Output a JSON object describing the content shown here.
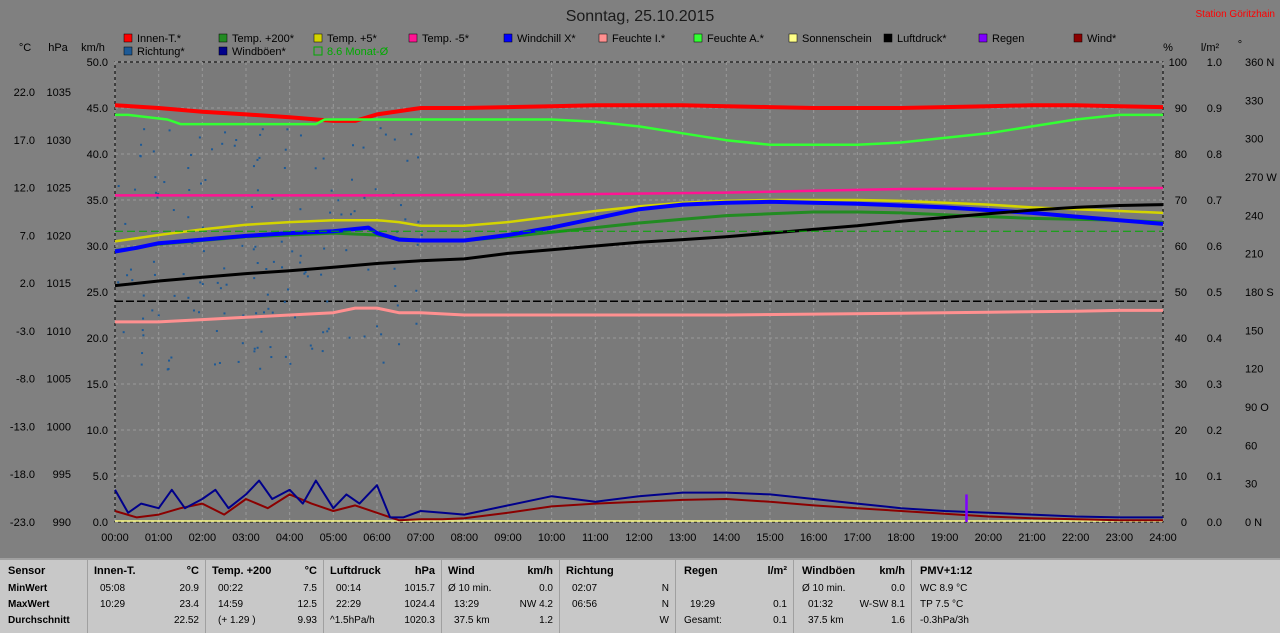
{
  "title": "Sonntag, 25.10.2015",
  "station": "Station Göritzhain",
  "left_units": {
    "c": "°C",
    "hpa": "hPa",
    "kmh": "km/h"
  },
  "right_units": {
    "pct": "%",
    "lm2": "l/m²",
    "deg": "°"
  },
  "legend": [
    {
      "label": "Innen-T.*",
      "color": "#ff0000"
    },
    {
      "label": "Temp. +200*",
      "color": "#228b22"
    },
    {
      "label": "Temp. +5*",
      "color": "#d4d400"
    },
    {
      "label": "Temp. -5*",
      "color": "#ff1493"
    },
    {
      "label": "Windchill X*",
      "color": "#0000ff"
    },
    {
      "label": "Feuchte I.*",
      "color": "#ff9090"
    },
    {
      "label": "Feuchte A.*",
      "color": "#33ff33"
    },
    {
      "label": "Sonnenschein",
      "color": "#ffff88"
    },
    {
      "label": "Luftdruck*",
      "color": "#000000"
    },
    {
      "label": "Regen",
      "color": "#8000ff"
    },
    {
      "label": "Wind*",
      "color": "#8b0000"
    },
    {
      "label": "Richtung*",
      "color": "#1e5a96"
    },
    {
      "label": "Windböen*",
      "color": "#00008b"
    },
    {
      "label": "8.6 Monat-Ø",
      "color": "#00aa00"
    }
  ],
  "chart_data": {
    "type": "line",
    "x_ticks": [
      "00:00",
      "01:00",
      "02:00",
      "03:00",
      "04:00",
      "05:00",
      "06:00",
      "07:00",
      "08:00",
      "09:00",
      "10:00",
      "11:00",
      "12:00",
      "13:00",
      "14:00",
      "15:00",
      "16:00",
      "17:00",
      "18:00",
      "19:00",
      "20:00",
      "21:00",
      "22:00",
      "23:00",
      "24:00"
    ],
    "axis_temp_c": [
      "22.0",
      "17.0",
      "12.0",
      "7.0",
      "2.0",
      "-3.0",
      "-8.0",
      "-13.0",
      "-18.0",
      "-23.0"
    ],
    "axis_pressure_hpa": [
      "1035",
      "1030",
      "1025",
      "1020",
      "1015",
      "1010",
      "1005",
      "1000",
      "995",
      "990"
    ],
    "axis_wind_kmh": [
      "50.0",
      "45.0",
      "40.0",
      "35.0",
      "30.0",
      "25.0",
      "20.0",
      "15.0",
      "10.0",
      "5.0",
      "0.0"
    ],
    "axis_humidity_pct": [
      "100",
      "90",
      "80",
      "70",
      "60",
      "50",
      "40",
      "30",
      "20",
      "10",
      "0"
    ],
    "axis_rain_lm2": [
      "1.0",
      "0.9",
      "0.8",
      "0.7",
      "0.6",
      "0.5",
      "0.4",
      "0.3",
      "0.2",
      "0.1",
      "0.0"
    ],
    "axis_direction_deg": [
      "360 N",
      "330",
      "300",
      "270 W",
      "240",
      "210",
      "180 S",
      "150",
      "120",
      "90 O",
      "60",
      "30",
      "0 N"
    ],
    "series": [
      {
        "name": "Innen-T.*",
        "axis": "temp",
        "x": [
          0,
          1,
          2,
          3,
          4,
          5,
          5.5,
          6,
          7,
          8,
          9,
          10,
          11,
          12,
          13,
          14,
          15,
          16,
          17,
          18,
          19,
          20,
          21,
          22,
          23,
          24
        ],
        "y": [
          22.3,
          22.0,
          21.6,
          21.3,
          21.0,
          20.6,
          20.6,
          21.3,
          22.0,
          22.0,
          22.1,
          22.2,
          22.3,
          22.3,
          22.3,
          22.2,
          22.1,
          22.0,
          22.0,
          22.0,
          22.1,
          22.2,
          22.3,
          22.3,
          22.2,
          22.1
        ]
      },
      {
        "name": "Feuchte A.*",
        "axis": "pct",
        "x": [
          0,
          0.3,
          1.2,
          1.5,
          2,
          3,
          4,
          4.6,
          4.8,
          5,
          6,
          7,
          8,
          9,
          10,
          11,
          12,
          13,
          14,
          15,
          16,
          17,
          18,
          19,
          20,
          21,
          22,
          23,
          24
        ],
        "y": [
          88.5,
          88.5,
          87.5,
          86.5,
          86.5,
          86.5,
          86.5,
          86.5,
          87.5,
          87.5,
          87.5,
          87.5,
          87.5,
          87.5,
          87.5,
          87,
          86,
          84.5,
          83,
          82,
          82,
          82,
          82.5,
          83.5,
          84.5,
          86,
          87.5,
          88.5,
          88.5
        ]
      },
      {
        "name": "Temp. -5*",
        "axis": "temp",
        "x": [
          0,
          6,
          10,
          14,
          16,
          18,
          24
        ],
        "y": [
          12.5,
          12.5,
          12.6,
          12.8,
          13.0,
          13.2,
          13.3
        ]
      },
      {
        "name": "Temp. +5*",
        "axis": "temp",
        "x": [
          0,
          1,
          2,
          3,
          4,
          5,
          6,
          6.5,
          7,
          8,
          9,
          10,
          11,
          12,
          13,
          14,
          15,
          16,
          17,
          18,
          19,
          20,
          21,
          22,
          23,
          24
        ],
        "y": [
          7.5,
          8.2,
          8.8,
          9.3,
          9.6,
          9.8,
          9.8,
          9.6,
          9.2,
          9.2,
          9.6,
          10.2,
          10.8,
          11.3,
          11.7,
          11.9,
          12.0,
          12.0,
          12.0,
          11.9,
          11.7,
          11.5,
          11.2,
          11.0,
          10.8,
          10.6
        ]
      },
      {
        "name": "Temp. +200*",
        "axis": "temp",
        "x": [
          0,
          1,
          2,
          3,
          4,
          5,
          6,
          6.5,
          7,
          8,
          9,
          10,
          11,
          12,
          13,
          14,
          15,
          16,
          17,
          18,
          19,
          20,
          21,
          22,
          23,
          24
        ],
        "y": [
          6.5,
          7.2,
          7.6,
          8.0,
          8.2,
          8.4,
          8.2,
          7.8,
          7.6,
          7.6,
          8.0,
          8.5,
          9.0,
          9.5,
          9.9,
          10.3,
          10.5,
          10.7,
          10.7,
          10.6,
          10.4,
          10.2,
          10.0,
          9.9,
          9.8,
          9.6
        ]
      },
      {
        "name": "Windchill X*",
        "axis": "temp",
        "x": [
          0,
          0.5,
          1,
          2,
          3,
          4,
          5,
          5.8,
          6,
          6.5,
          7,
          8,
          9,
          10,
          11,
          12,
          13,
          14,
          15,
          16,
          17,
          18,
          19,
          20,
          21,
          22,
          23,
          24
        ],
        "y": [
          6.4,
          6.8,
          7.3,
          7.7,
          8.1,
          8.4,
          8.6,
          9.0,
          8.4,
          7.7,
          7.6,
          7.6,
          8.2,
          9.0,
          10.0,
          11.0,
          11.5,
          11.7,
          11.8,
          11.7,
          11.6,
          11.4,
          11.2,
          10.9,
          10.6,
          10.2,
          9.8,
          9.4
        ]
      },
      {
        "name": "Luftdruck*",
        "axis": "hpa",
        "x": [
          0,
          1,
          2,
          3,
          4,
          5,
          6,
          7,
          8,
          9,
          10,
          11,
          12,
          13,
          14,
          15,
          16,
          17,
          18,
          19,
          20,
          21,
          22,
          23,
          24
        ],
        "y": [
          1015.7,
          1016.2,
          1016.6,
          1017.0,
          1017.3,
          1017.7,
          1018.1,
          1018.4,
          1018.6,
          1019.2,
          1019.6,
          1020.0,
          1020.4,
          1020.7,
          1021.0,
          1021.4,
          1021.8,
          1022.2,
          1022.7,
          1023.1,
          1023.5,
          1023.9,
          1024.2,
          1024.4,
          1024.5
        ]
      },
      {
        "name": "Feuchte I.*",
        "axis": "pct",
        "x": [
          0,
          1,
          2,
          3,
          4,
          5,
          5.5,
          6,
          6.5,
          7,
          8,
          9,
          10,
          12,
          14,
          16,
          18,
          20,
          22,
          23,
          24
        ],
        "y": [
          43.5,
          43.5,
          44,
          44.5,
          45,
          45.5,
          46.5,
          46.5,
          45.5,
          45.5,
          45,
          45,
          45,
          45,
          45,
          45.2,
          45.4,
          45.6,
          45.8,
          46,
          46
        ]
      },
      {
        "name": "Wind*",
        "axis": "kmh",
        "x": [
          0,
          0.5,
          1,
          1.5,
          2,
          2.5,
          3,
          3.5,
          4,
          4.5,
          5,
          5.5,
          6,
          6.5,
          7,
          7.5,
          8,
          9,
          10,
          11,
          12,
          13,
          14,
          15,
          16,
          17,
          18,
          19,
          20,
          21,
          22,
          23,
          24
        ],
        "y": [
          1.2,
          0.5,
          0.8,
          1.5,
          2.0,
          0.8,
          2.5,
          1.5,
          3.0,
          2.0,
          1.2,
          1.8,
          1.0,
          0.2,
          0.3,
          0.3,
          0.4,
          1.0,
          1.7,
          2.0,
          2.2,
          2.4,
          2.5,
          2.2,
          1.8,
          1.5,
          1.2,
          0.9,
          0.6,
          0.4,
          0.3,
          0.2,
          0.2
        ]
      },
      {
        "name": "Windböen*",
        "axis": "kmh",
        "x": [
          0,
          0.3,
          0.6,
          1,
          1.3,
          1.6,
          2,
          2.3,
          2.6,
          3,
          3.3,
          3.6,
          4,
          4.3,
          4.6,
          5,
          5.3,
          5.6,
          6,
          6.3,
          6.6,
          7,
          7.5,
          8,
          9,
          10,
          11,
          12,
          13,
          14,
          15,
          16,
          17,
          18,
          19,
          20,
          21,
          22,
          23,
          24
        ],
        "y": [
          3.5,
          1.0,
          2.0,
          1.5,
          3.5,
          1.5,
          2.5,
          3.5,
          1.5,
          3.0,
          4.5,
          2.5,
          3.5,
          2.0,
          4.5,
          1.5,
          3.0,
          2.0,
          4.0,
          0.5,
          0.5,
          1.2,
          1.0,
          0.8,
          1.8,
          2.8,
          2.2,
          2.8,
          3.2,
          3.2,
          3.0,
          2.5,
          2.0,
          1.5,
          1.2,
          1.0,
          0.8,
          0.6,
          0.5,
          0.5
        ]
      },
      {
        "name": "8.6 Monat-Ø",
        "axis": "temp",
        "x": [
          0,
          24
        ],
        "y": [
          8.6,
          8.6
        ]
      }
    ],
    "reference_line_pct": 48,
    "rain_event": {
      "time": 19.5,
      "value_lm2": 0.1
    }
  },
  "stats": {
    "sensor": {
      "h": "Sensor",
      "r1": "MinWert",
      "r2": "MaxWert",
      "r3": "Durchschnitt"
    },
    "innen": {
      "h": "Innen-T.",
      "u": "°C",
      "r1a": "05:08",
      "r1b": "20.9",
      "r2a": "10:29",
      "r2b": "23.4",
      "r3b": "22.52"
    },
    "temp200": {
      "h": "Temp. +200",
      "u": "°C",
      "r1a": "00:22",
      "r1b": "7.5",
      "r2a": "14:59",
      "r2b": "12.5",
      "r3a": "(+ 1.29 )",
      "r3b": "9.93"
    },
    "luftdruck": {
      "h": "Luftdruck",
      "u": "hPa",
      "r1a": "00:14",
      "r1b": "1015.7",
      "r2a": "22:29",
      "r2b": "1024.4",
      "r3a": "^1.5hPa/h",
      "r3b": "1020.3"
    },
    "wind": {
      "h": "Wind",
      "u": "km/h",
      "r1a": "Ø 10 min.",
      "r1b": "0.0",
      "r2a": "13:29",
      "r2b": "NW 4.2",
      "r3a": "37.5 km",
      "r3b": "1.2"
    },
    "richtung": {
      "h": "Richtung",
      "r1a": "02:07",
      "r1b": "N",
      "r2a": "06:56",
      "r2b": "N",
      "r3b": "W"
    },
    "regen": {
      "h": "Regen",
      "u": "l/m²",
      "r2a": "19:29",
      "r2b": "0.1",
      "r3a": "Gesamt:",
      "r3b": "0.1"
    },
    "windboeen": {
      "h": "Windböen",
      "u": "km/h",
      "r1a": "Ø 10 min.",
      "r1b": "0.0",
      "r2a": "01:32",
      "r2b": "W-SW 8.1",
      "r3a": "37.5 km",
      "r3b": "1.6"
    },
    "pmv": {
      "h": "PMV+1:12",
      "r1a": "WC 8.9 °C",
      "r2a": "TP 7.5 °C",
      "r3a": "-0.3hPa/3h"
    }
  }
}
